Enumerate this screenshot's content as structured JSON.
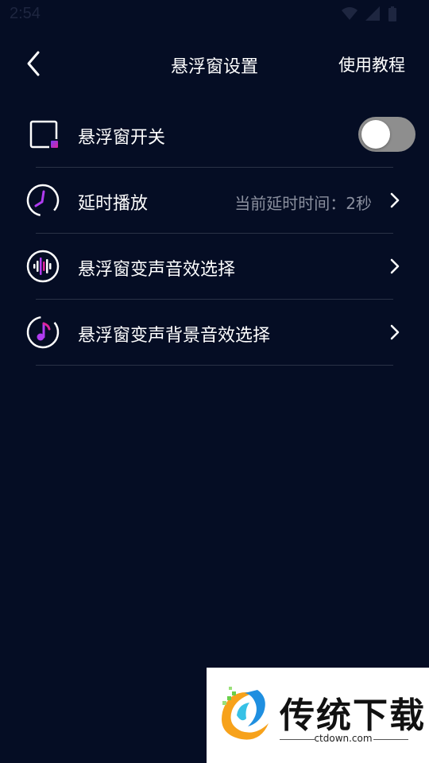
{
  "status_bar": {
    "time": "2:54"
  },
  "header": {
    "title": "悬浮窗设置",
    "right_action": "使用教程",
    "back_icon": "chevron-left-icon"
  },
  "settings": {
    "items": [
      {
        "label": "悬浮窗开关",
        "icon": "floating-window-icon",
        "control": "toggle",
        "toggle_on": false
      },
      {
        "label": "延时播放",
        "icon": "clock-icon",
        "value": "当前延时时间：2秒",
        "control": "chevron"
      },
      {
        "label": "悬浮窗变声音效选择",
        "icon": "waveform-icon",
        "control": "chevron"
      },
      {
        "label": "悬浮窗变声背景音效选择",
        "icon": "music-note-icon",
        "control": "chevron"
      }
    ]
  },
  "watermark": {
    "title": "传统下载",
    "subtitle": "ctdown.com"
  },
  "colors": {
    "background": "#050d24",
    "accent_purple": "#b03cf0",
    "accent_magenta": "#e0249a",
    "divider": "#2a3246",
    "value_text": "#8a8f9e",
    "toggle_track": "#8e8e8e"
  }
}
